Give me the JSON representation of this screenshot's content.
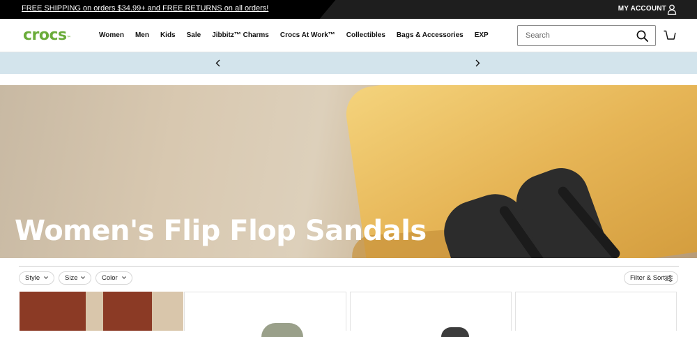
{
  "promo": {
    "text": "FREE SHIPPING on orders $34.99+ and FREE RETURNS on all orders!",
    "account_label": "MY ACCOUNT"
  },
  "header": {
    "logo": "crocs",
    "nav": [
      "Women",
      "Men",
      "Kids",
      "Sale",
      "Jibbitz™ Charms",
      "Crocs At Work™",
      "Collectibles",
      "Bags & Accessories",
      "EXP"
    ],
    "search_placeholder": "Search"
  },
  "hero": {
    "title": "Women's Flip Flop Sandals"
  },
  "filters": {
    "chips": [
      "Style",
      "Size",
      "Color"
    ],
    "filter_sort_label": "Filter & Sort"
  },
  "colors": {
    "brand_green": "#6aac3a",
    "promo_bg": "#000000",
    "strip_bg": "#d3e4ec"
  },
  "icons": {
    "account": "user-icon",
    "search": "search-icon",
    "cart": "cart-icon",
    "prev": "chevron-left-icon",
    "next": "chevron-right-icon",
    "chip_chevron": "chevron-down-icon",
    "filter": "sliders-icon"
  }
}
